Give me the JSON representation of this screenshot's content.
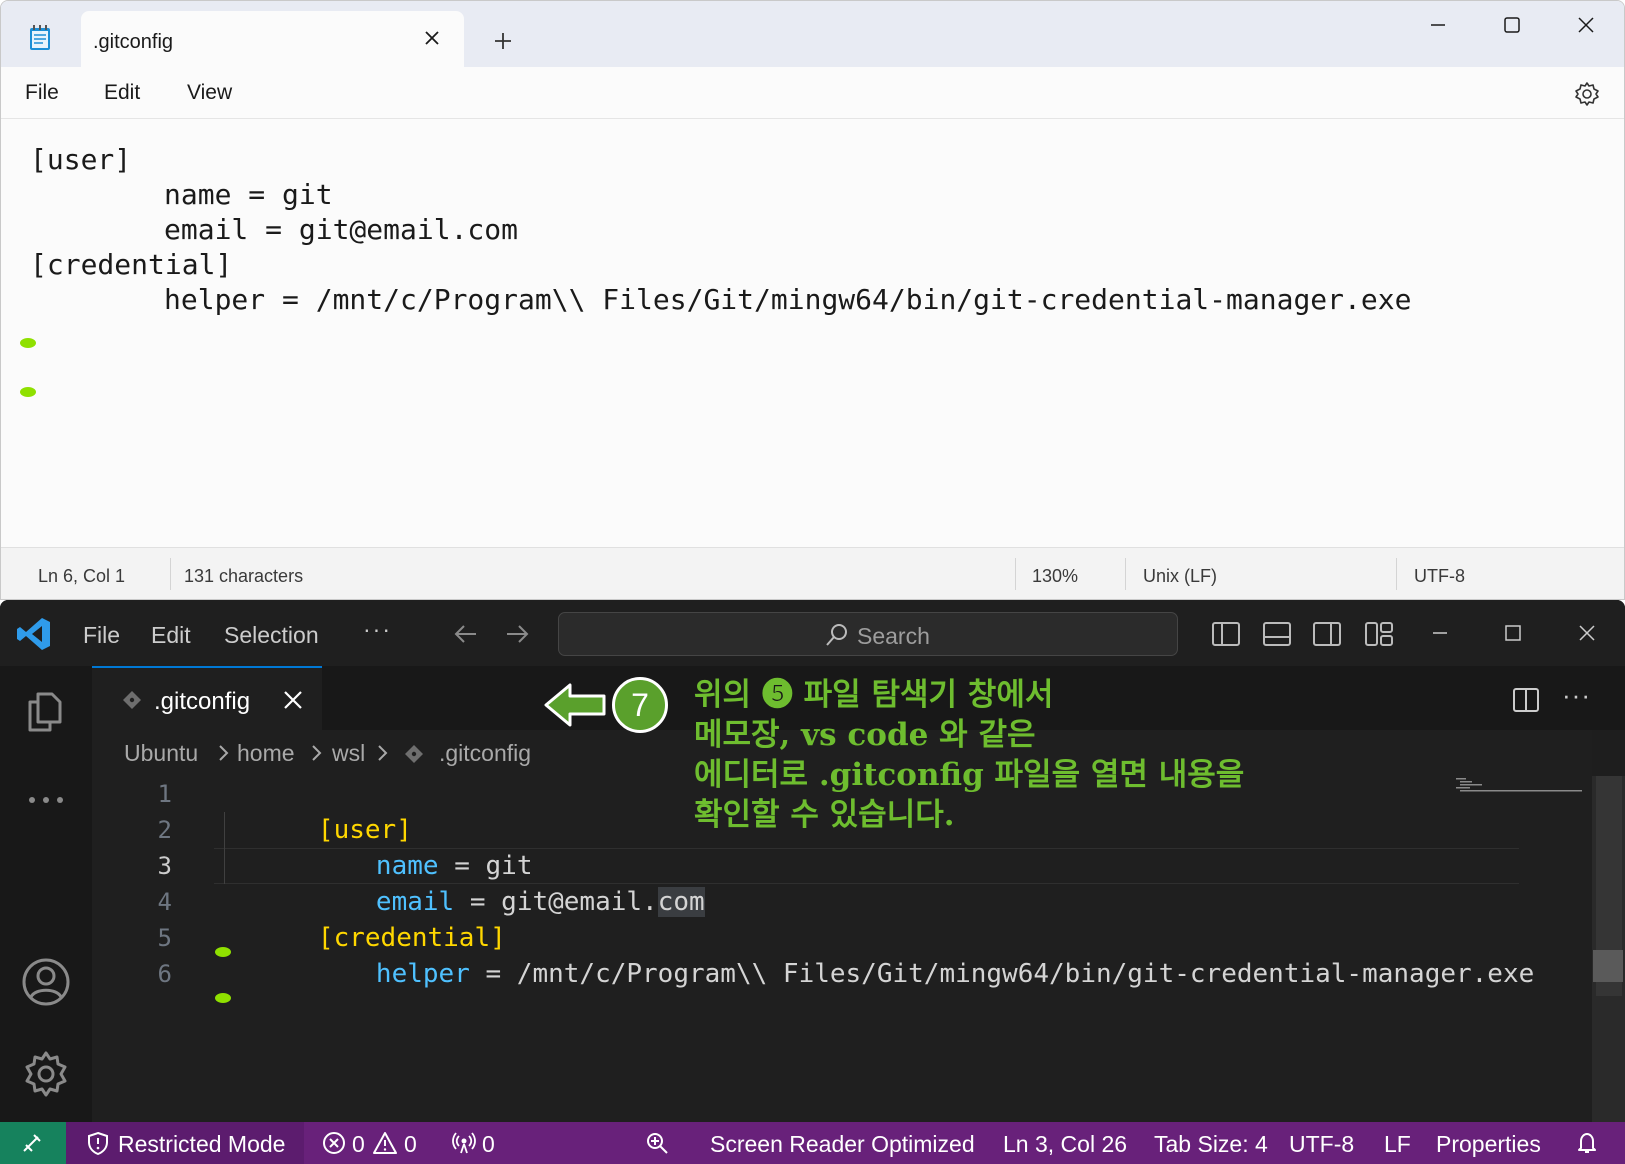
{
  "notepad": {
    "tab_title": ".gitconfig",
    "menu": {
      "file": "File",
      "edit": "Edit",
      "view": "View"
    },
    "lines": [
      "[user]",
      "name = git",
      "email = git@email.com",
      "[credential]",
      "helper = /mnt/c/Program\\\\ Files/Git/mingw64/bin/git-credential-manager.exe"
    ],
    "status": {
      "position": "Ln 6, Col 1",
      "characters": "131 characters",
      "zoom": "130%",
      "line_endings": "Unix (LF)",
      "encoding": "UTF-8"
    }
  },
  "vscode": {
    "menu": {
      "file": "File",
      "edit": "Edit",
      "selection": "Selection",
      "more": "···"
    },
    "search_placeholder": "Search",
    "tab_title": ".gitconfig",
    "breadcrumb": [
      "Ubuntu",
      "home",
      "wsl",
      ".gitconfig"
    ],
    "line_numbers": [
      "1",
      "2",
      "3",
      "4",
      "5",
      "6"
    ],
    "code": {
      "l1": "[user]",
      "l2_key": "name",
      "l2_rest": " = git",
      "l3_key": "email",
      "l3_rest": " = git@email.",
      "l3_sel": "com",
      "l4": "[credential]",
      "l5_key": "helper",
      "l5_rest": " = /mnt/c/Program\\\\ Files/Git/mingw64/bin/git-credential-manager.exe"
    },
    "status": {
      "restricted": "Restricted Mode",
      "errors": "0",
      "warnings": "0",
      "ports": "0",
      "screen_reader": "Screen Reader Optimized",
      "position": "Ln 3, Col 26",
      "tab_size": "Tab Size: 4",
      "encoding": "UTF-8",
      "eol": "LF",
      "language": "Properties"
    },
    "colors": {
      "statusbar": "#68217a",
      "remote": "#16825d",
      "accent": "#0078d4"
    }
  },
  "annotation": {
    "badge": "7",
    "text": "위의 ❺ 파일 탐색기 창에서\n메모장, vs code 와 같은\n에디터로 .gitconfig 파일을 열면 내용을\n확인할 수 있습니다."
  }
}
